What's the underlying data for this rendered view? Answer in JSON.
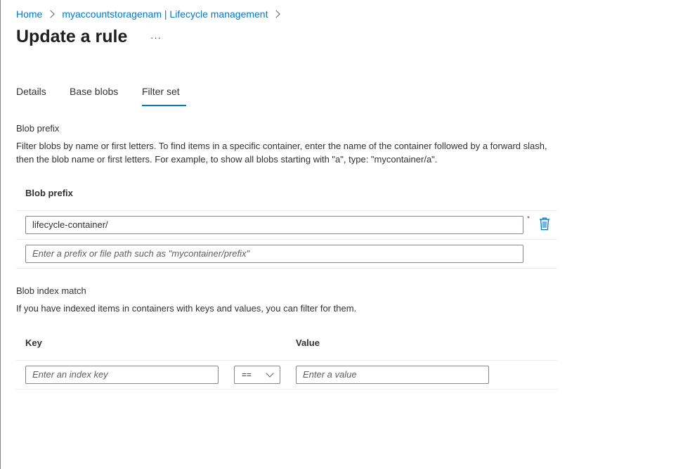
{
  "breadcrumb": {
    "items": [
      "Home",
      "myaccountstoragenam | Lifecycle management"
    ]
  },
  "page": {
    "title": "Update a rule",
    "more_label": "···"
  },
  "tabs": [
    {
      "label": "Details",
      "selected": false
    },
    {
      "label": "Base blobs",
      "selected": false
    },
    {
      "label": "Filter set",
      "selected": true
    }
  ],
  "blob_prefix": {
    "section_title": "Blob prefix",
    "description": "Filter blobs by name or first letters. To find items in a specific container, enter the name of the container followed by a forward slash, then the blob name or first letters. For example, to show all blobs starting with \"a\", type: \"mycontainer/a\".",
    "column_header": "Blob prefix",
    "rows": [
      {
        "value": "lifecycle-container/"
      }
    ],
    "required_mark": "*",
    "new_placeholder": "Enter a prefix or file path such as \"mycontainer/prefix\""
  },
  "index_match": {
    "section_title": "Blob index match",
    "description": "If you have indexed items in containers with keys and values, you can filter for them.",
    "key_header": "Key",
    "value_header": "Value",
    "key_placeholder": "Enter an index key",
    "operator": "==",
    "value_placeholder": "Enter a value"
  },
  "colors": {
    "accent": "#0078d4",
    "text": "#323130",
    "border": "#8a8886",
    "divider": "#edebe9"
  },
  "icons": {
    "breadcrumb_separator": "chevron-right-icon",
    "delete": "trash-icon",
    "dropdown": "chevron-down-icon"
  }
}
